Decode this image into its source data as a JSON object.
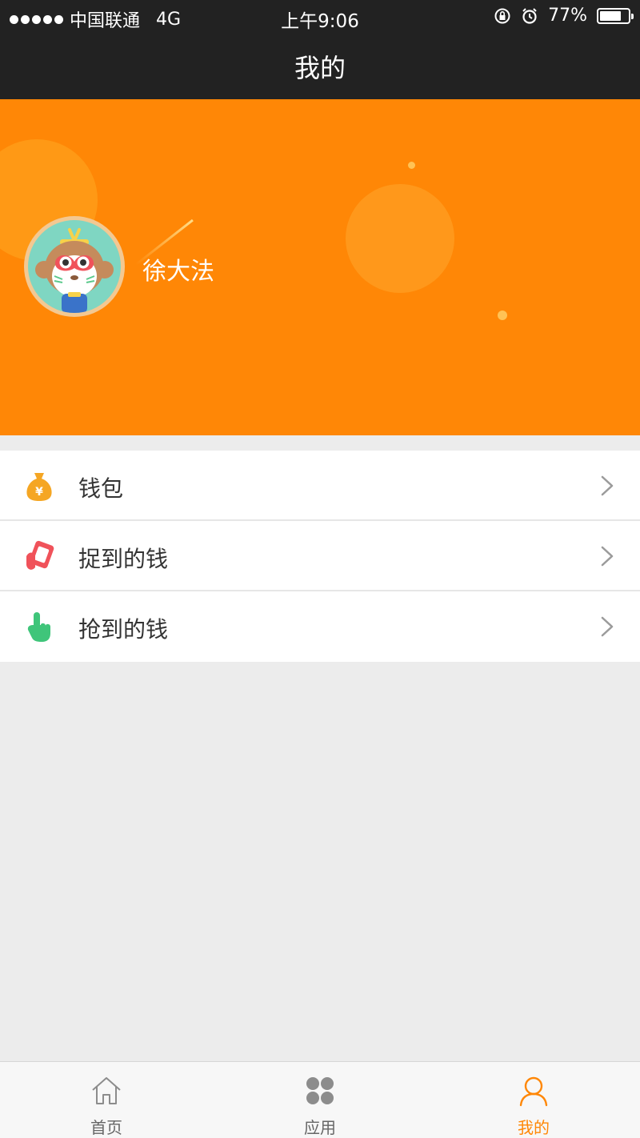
{
  "status_bar": {
    "carrier": "中国联通",
    "network": "4G",
    "time": "上午9:06",
    "battery": "77%",
    "battery_level": 0.77
  },
  "nav": {
    "title": "我的"
  },
  "profile": {
    "username": "徐大法"
  },
  "menu": [
    {
      "label": "钱包",
      "icon": "money-bag-icon",
      "color": "#f5a623"
    },
    {
      "label": "捉到的钱",
      "icon": "red-envelope-catch-icon",
      "color": "#f0525a"
    },
    {
      "label": "抢到的钱",
      "icon": "pointing-hand-icon",
      "color": "#3fc57a"
    }
  ],
  "tab_bar": {
    "tabs": [
      {
        "label": "首页",
        "icon": "home-icon",
        "active": false
      },
      {
        "label": "应用",
        "icon": "apps-grid-icon",
        "active": false
      },
      {
        "label": "我的",
        "icon": "user-icon",
        "active": true
      }
    ]
  },
  "colors": {
    "accent": "#ff8706",
    "nav_background": "#222222",
    "page_background": "#ececec"
  }
}
